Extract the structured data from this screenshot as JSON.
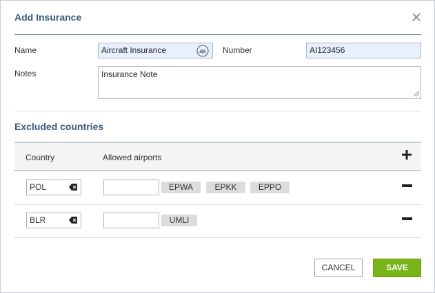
{
  "dialog": {
    "title": "Add Insurance",
    "close_icon": "close-icon"
  },
  "form": {
    "name_label": "Name",
    "name_value": "Aircraft Insurance",
    "name_icon": "fingerprint-icon",
    "number_label": "Number",
    "number_value": "AI123456",
    "notes_label": "Notes",
    "notes_value": "Insurance Note"
  },
  "excluded": {
    "title": "Excluded countries",
    "col_country": "Country",
    "col_airports": "Allowed airports",
    "add_icon": "plus-icon",
    "rows": [
      {
        "country": "POL",
        "airports": [
          "EPWA",
          "EPKK",
          "EPPO"
        ]
      },
      {
        "country": "BLR",
        "airports": [
          "UMLI"
        ]
      }
    ]
  },
  "footer": {
    "cancel_label": "CANCEL",
    "save_label": "SAVE"
  },
  "colors": {
    "heading": "#3a5a78",
    "save_button": "#7ab317",
    "field_bg": "#e8f0fe"
  }
}
